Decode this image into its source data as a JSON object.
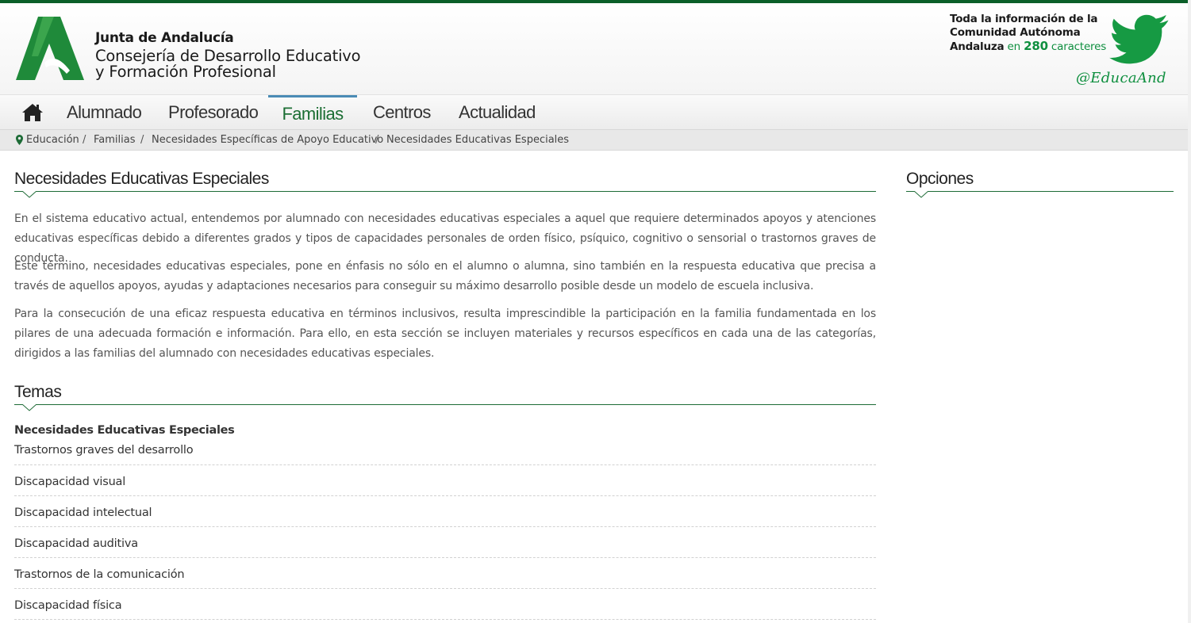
{
  "header": {
    "brand_line1": "Junta de Andalucía",
    "brand_line2a": "Consejería de Desarrollo Educativo",
    "brand_line2b": "y Formación Profesional",
    "twitter_line1": "Toda la información de la",
    "twitter_line2": "Comunidad Autónoma",
    "twitter_line3_a": "Andaluza",
    "twitter_line3_b": " en ",
    "twitter_line3_c": "280",
    "twitter_line3_d": " caracteres",
    "twitter_handle": "@EducaAnd"
  },
  "nav": {
    "items": [
      {
        "label": "Alumnado",
        "active": false
      },
      {
        "label": "Profesorado",
        "active": false
      },
      {
        "label": "Familias",
        "active": true
      },
      {
        "label": "Centros",
        "active": false
      },
      {
        "label": "Actualidad",
        "active": false
      }
    ]
  },
  "breadcrumb": {
    "items": [
      "Educación",
      "Familias",
      "Necesidades Específicas de Apoyo Educativo",
      "Necesidades Educativas Especiales"
    ],
    "separator": "/"
  },
  "main": {
    "title": "Necesidades Educativas Especiales",
    "paragraphs": [
      "En el sistema educativo actual, entendemos por alumnado con necesidades educativas especiales a aquel que requiere determinados apoyos y atenciones educativas específicas debido a diferentes grados y tipos de capacidades personales de orden físico, psíquico, cognitivo o sensorial o trastornos graves de conducta.",
      "Este término, necesidades educativas especiales, pone en énfasis no sólo en el alumno o alumna, sino también en la respuesta educativa que precisa a través de aquellos apoyos, ayudas y adaptaciones necesarios para conseguir su máximo desarrollo posible desde un modelo de escuela inclusiva.",
      "Para la consecución de una eficaz respuesta educativa en términos inclusivos, resulta imprescindible la participación en la familia fundamentada en los pilares de una adecuada formación e información. Para ello,  en esta sección se incluyen materiales y recursos específicos en cada una de las categorías, dirigidos a las familias del alumnado con necesidades educativas especiales."
    ],
    "topics_title": "Temas",
    "topics_group": "Necesidades Educativas Especiales",
    "topics": [
      "Trastornos graves del desarrollo",
      "Discapacidad visual",
      "Discapacidad intelectual",
      "Discapacidad auditiva",
      "Trastornos de la comunicación",
      "Discapacidad física"
    ]
  },
  "sidebar": {
    "title": "Opciones"
  },
  "colors": {
    "brand_green": "#0f8f3f",
    "dark_green": "#1d6b36",
    "nav_active_border": "#4a8bb5"
  }
}
